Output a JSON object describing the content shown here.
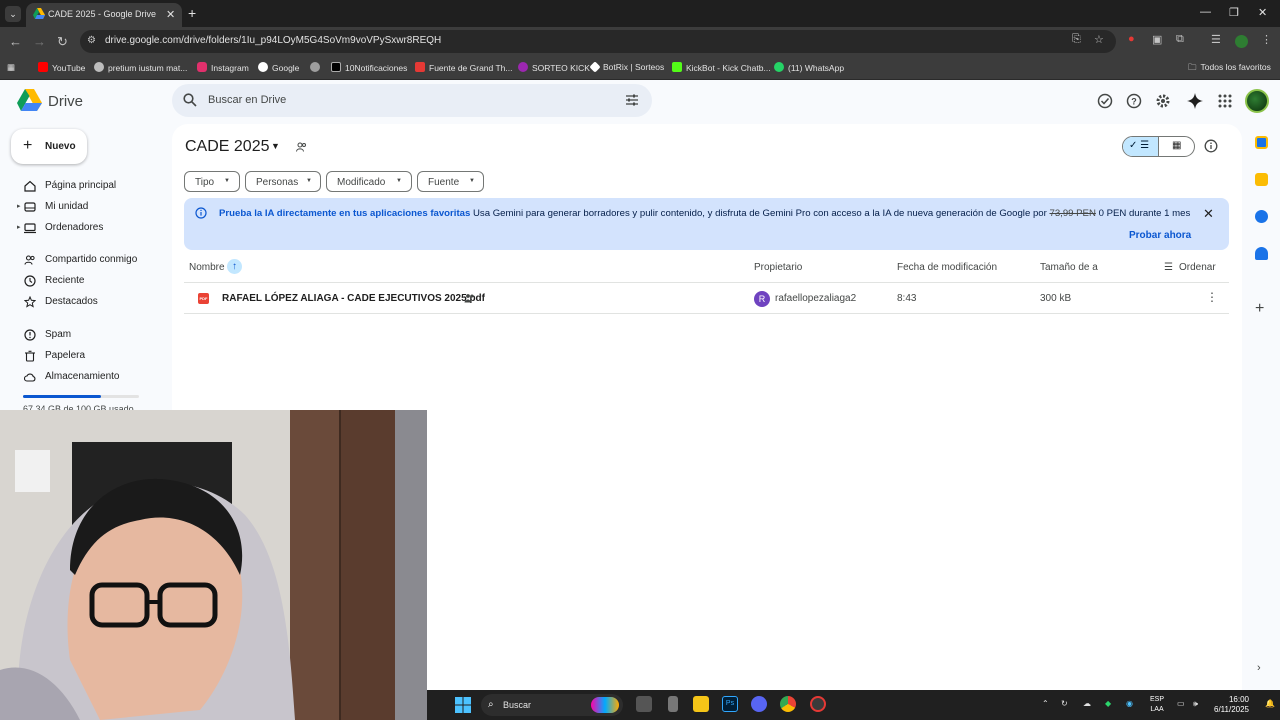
{
  "browser": {
    "tab_title": "CADE 2025 - Google Drive",
    "tab_close": "✕",
    "url": "drive.google.com/drive/folders/1Iu_p94LOyM5G4SoVm9voVPySxwr8REQH",
    "bookmarks": [
      {
        "label": "YouTube",
        "color": "#ff0000"
      },
      {
        "label": "pretium iustum mat...",
        "color": "#bdbdbd"
      },
      {
        "label": "Instagram",
        "color": "#e1306c"
      },
      {
        "label": "Google",
        "color": "#ffffff"
      },
      {
        "label": "",
        "color": "#9e9e9e"
      },
      {
        "label": "10Notificaciones",
        "color": "#000000"
      },
      {
        "label": "Fuente de Grand Th...",
        "color": "#e53935"
      },
      {
        "label": "SORTEO KICK",
        "color": "#9c27b0"
      },
      {
        "label": "BotRix | Sorteos",
        "color": "#ffffff"
      },
      {
        "label": "KickBot - Kick Chatb...",
        "color": "#53fc18"
      },
      {
        "label": "(11) WhatsApp",
        "color": "#25d366"
      }
    ],
    "all_bookmarks": "Todos los favoritos"
  },
  "drive": {
    "brand": "Drive",
    "search_placeholder": "Buscar en Drive",
    "new_button": "Nuevo",
    "nav": [
      {
        "label": "Página principal",
        "icon": "home-icon"
      },
      {
        "label": "Mi unidad",
        "icon": "my-drive-icon"
      },
      {
        "label": "Ordenadores",
        "icon": "computer-icon"
      },
      {
        "label": "Compartido conmigo",
        "icon": "shared-icon"
      },
      {
        "label": "Reciente",
        "icon": "clock-icon"
      },
      {
        "label": "Destacados",
        "icon": "star-icon"
      },
      {
        "label": "Spam",
        "icon": "spam-icon"
      },
      {
        "label": "Papelera",
        "icon": "trash-icon"
      },
      {
        "label": "Almacenamiento",
        "icon": "cloud-icon"
      }
    ],
    "storage_text": "67,34 GB de 100 GB usado",
    "folder_title": "CADE 2025",
    "filters": [
      "Tipo",
      "Personas",
      "Modificado",
      "Fuente"
    ],
    "banner": {
      "title": "Prueba la IA directamente en tus aplicaciones favoritas",
      "body_pre": "Usa Gemini para generar borradores y pulir contenido, y disfruta de Gemini Pro con acceso a la IA de nueva generación de Google por",
      "old_price": "73,99 PEN",
      "body_post": "0 PEN durante 1 mes",
      "cta": "Probar ahora"
    },
    "columns": {
      "name": "Nombre",
      "owner": "Propietario",
      "modified": "Fecha de modificación",
      "size": "Tamaño de a",
      "sort": "Ordenar"
    },
    "files": [
      {
        "name": "RAFAEL LÓPEZ ALIAGA - CADE EJECUTIVOS 2025.pdf",
        "owner_initial": "R",
        "owner": "rafaellopezaliaga2",
        "modified": "8:43",
        "size": "300 kB"
      }
    ]
  },
  "taskbar": {
    "search": "Buscar",
    "lang_1": "ESP",
    "lang_2": "LAA",
    "time": "16:00",
    "date": "6/11/2025"
  }
}
